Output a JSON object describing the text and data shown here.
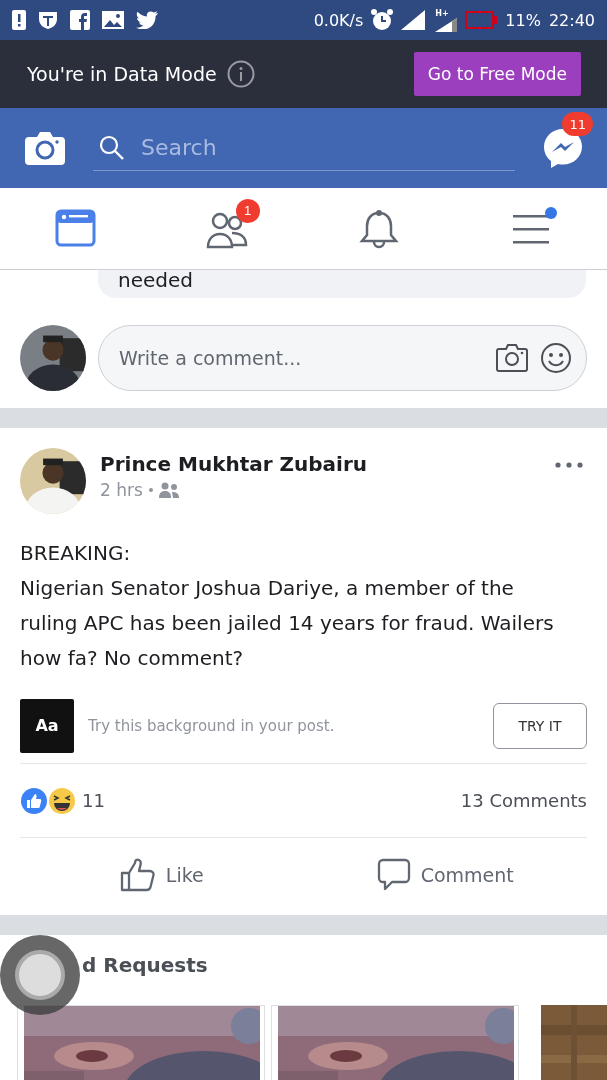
{
  "status_bar": {
    "speed": "0.0K/s",
    "network": "H+",
    "battery": "11%",
    "time": "22:40"
  },
  "data_mode_bar": {
    "message": "You're in Data Mode",
    "button": "Go to Free Mode"
  },
  "header": {
    "search": {
      "placeholder": "Search"
    },
    "messenger_badge": "11"
  },
  "nav_tabs": [
    {
      "kind": "feed",
      "selected": true
    },
    {
      "kind": "friends",
      "selected": false,
      "badge": "1"
    },
    {
      "kind": "notifications",
      "selected": false
    },
    {
      "kind": "menu",
      "selected": false,
      "dot": true
    }
  ],
  "previous_comment": {
    "text": "needed"
  },
  "comment_field": {
    "placeholder": "Write a comment..."
  },
  "post": {
    "author": "Prince Mukhtar Zubairu",
    "time": "2 hrs",
    "text": "BREAKING:\nNigerian Senator Joshua Dariye, a member of the ruling APC has been jailed 14 years for fraud. Wailers how fa? No comment?",
    "background_prompt": {
      "sample": "Aa",
      "text": "Try this background in your post.",
      "button": "TRY IT"
    },
    "reactions_count": "11",
    "comments_count": "13 Comments",
    "actions": [
      {
        "kind": "like",
        "label": "Like"
      },
      {
        "kind": "comment",
        "label": "Comment"
      }
    ]
  },
  "friend_requests": {
    "title": "d Requests"
  }
}
